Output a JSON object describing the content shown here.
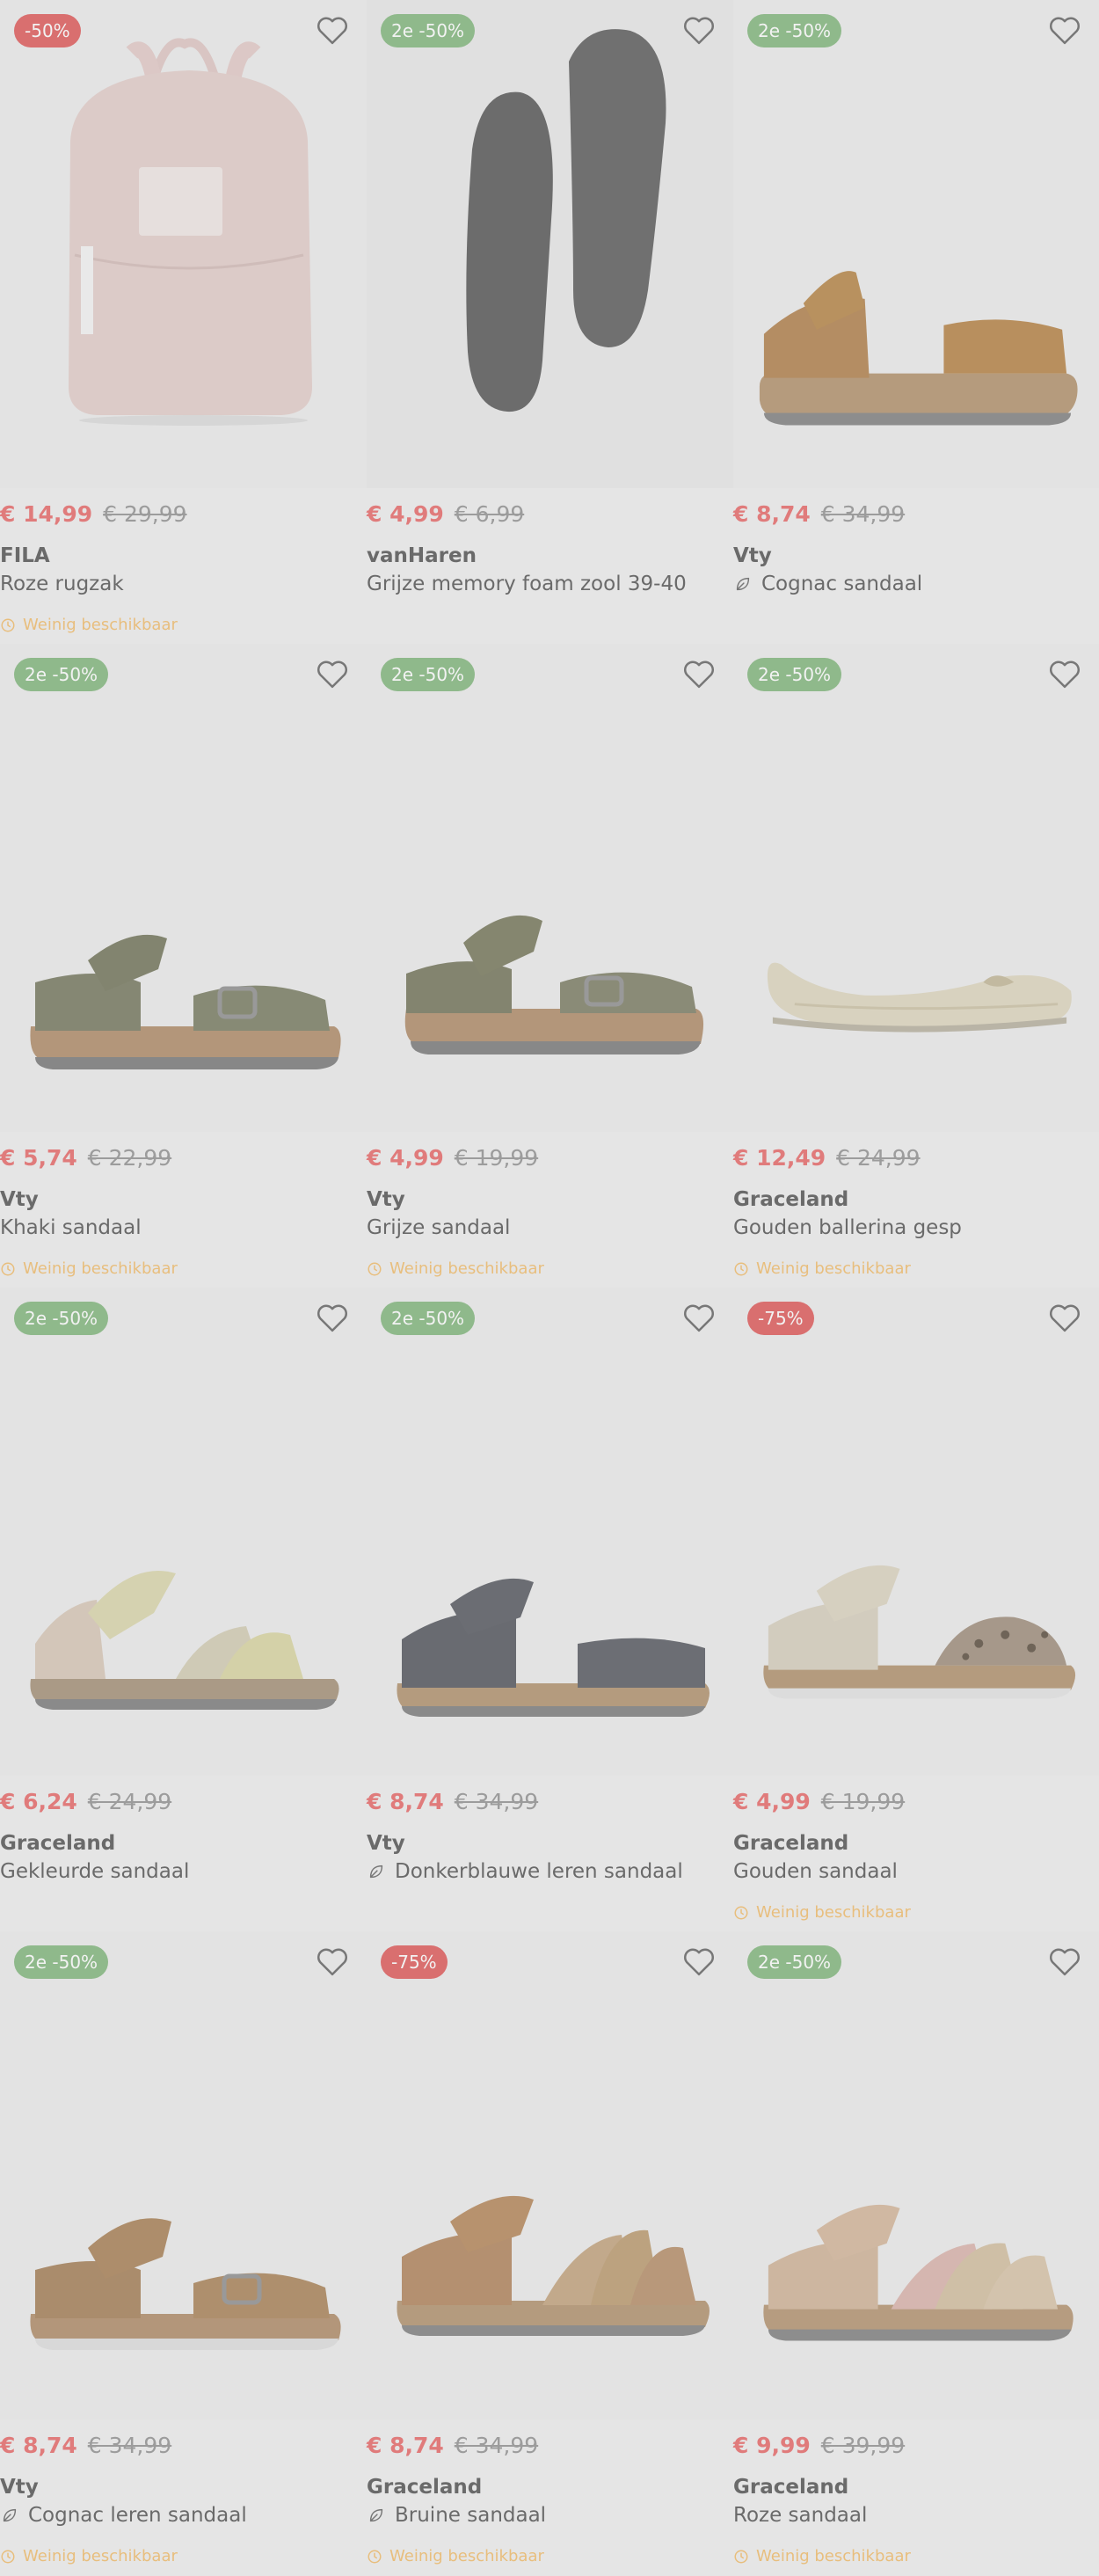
{
  "colors": {
    "price": "#e07b7b",
    "old_price": "#9c9c9c",
    "badge_green": "#8fb98b",
    "badge_red": "#d96f6f",
    "stock": "#e8be7d",
    "text": "#6a6a6a"
  },
  "products": [
    {
      "badge": "-50%",
      "badge_color": "red",
      "price": "€ 14,99",
      "old_price": "€ 29,99",
      "brand": "FILA",
      "name": "Roze rugzak",
      "sustainable": false,
      "stock": "Weinig beschikbaar",
      "image": "backpack"
    },
    {
      "badge": "2e -50%",
      "badge_color": "green",
      "price": "€ 4,99",
      "old_price": "€ 6,99",
      "brand": "vanHaren",
      "name": "Grijze memory foam zool 39-40",
      "sustainable": false,
      "stock": "",
      "image": "insoles"
    },
    {
      "badge": "2e -50%",
      "badge_color": "green",
      "price": "€ 8,74",
      "old_price": "€ 34,99",
      "brand": "Vty",
      "name": "Cognac sandaal",
      "sustainable": true,
      "stock": "",
      "image": "sandal-cognac"
    },
    {
      "badge": "2e -50%",
      "badge_color": "green",
      "price": "€ 5,74",
      "old_price": "€ 22,99",
      "brand": "Vty",
      "name": "Khaki sandaal",
      "sustainable": false,
      "stock": "Weinig beschikbaar",
      "image": "sandal-khaki"
    },
    {
      "badge": "2e -50%",
      "badge_color": "green",
      "price": "€ 4,99",
      "old_price": "€ 19,99",
      "brand": "Vty",
      "name": "Grijze sandaal",
      "sustainable": false,
      "stock": "Weinig beschikbaar",
      "image": "sandal-grey"
    },
    {
      "badge": "2e -50%",
      "badge_color": "green",
      "price": "€ 12,49",
      "old_price": "€ 24,99",
      "brand": "Graceland",
      "name": "Gouden ballerina gesp",
      "sustainable": false,
      "stock": "Weinig beschikbaar",
      "image": "ballerina-gold"
    },
    {
      "badge": "2e -50%",
      "badge_color": "green",
      "price": "€ 6,24",
      "old_price": "€ 24,99",
      "brand": "Graceland",
      "name": "Gekleurde sandaal",
      "sustainable": false,
      "stock": "",
      "image": "sandal-colored"
    },
    {
      "badge": "2e -50%",
      "badge_color": "green",
      "price": "€ 8,74",
      "old_price": "€ 34,99",
      "brand": "Vty",
      "name": "Donkerblauwe leren sandaal",
      "sustainable": true,
      "stock": "",
      "image": "sandal-navy"
    },
    {
      "badge": "-75%",
      "badge_color": "red",
      "price": "€ 4,99",
      "old_price": "€ 19,99",
      "brand": "Graceland",
      "name": "Gouden sandaal",
      "sustainable": false,
      "stock": "Weinig beschikbaar",
      "image": "sandal-gold-leopard"
    },
    {
      "badge": "2e -50%",
      "badge_color": "green",
      "price": "€ 8,74",
      "old_price": "€ 34,99",
      "brand": "Vty",
      "name": "Cognac leren sandaal",
      "sustainable": true,
      "stock": "Weinig beschikbaar",
      "image": "sandal-cognac-leather"
    },
    {
      "badge": "-75%",
      "badge_color": "red",
      "price": "€ 8,74",
      "old_price": "€ 34,99",
      "brand": "Graceland",
      "name": "Bruine sandaal",
      "sustainable": true,
      "stock": "Weinig beschikbaar",
      "image": "sandal-brown-braided"
    },
    {
      "badge": "2e -50%",
      "badge_color": "green",
      "price": "€ 9,99",
      "old_price": "€ 39,99",
      "brand": "Graceland",
      "name": "Roze sandaal",
      "sustainable": false,
      "stock": "Weinig beschikbaar",
      "image": "sandal-pink-braided"
    }
  ]
}
